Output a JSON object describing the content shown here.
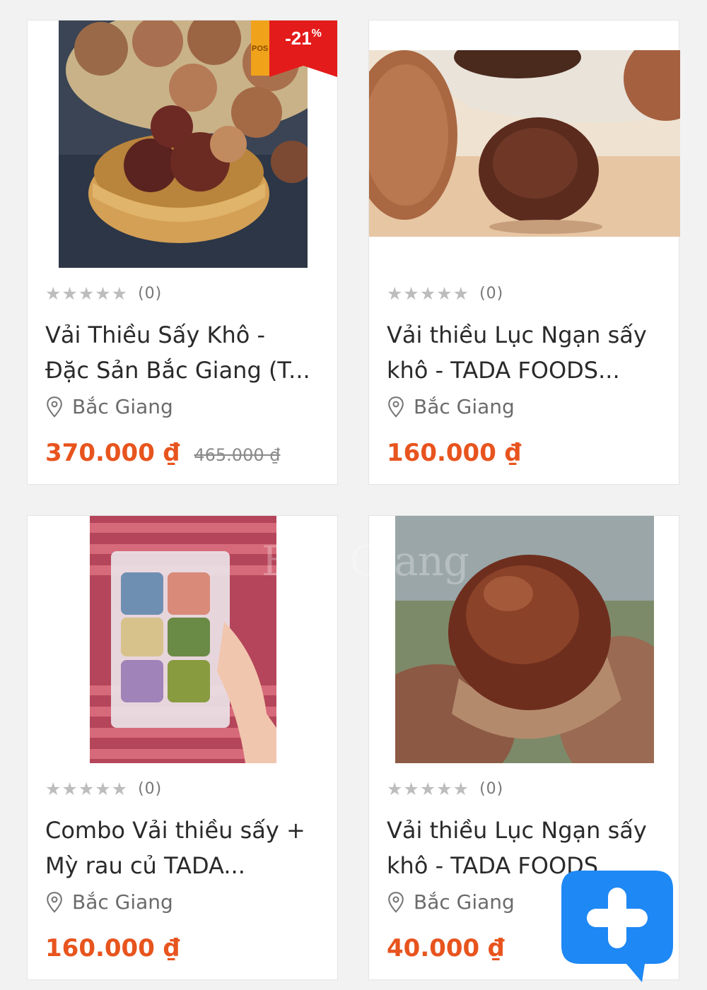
{
  "products": [
    {
      "rating_count": "(0)",
      "title_line1": "Vải Thiều Sấy Khô -",
      "title_line2": "Đặc Sản Bắc Giang (T...",
      "location": "Bắc Giang",
      "price": "370.000 ₫",
      "old_price": "465.000 ₫",
      "discount": "-21",
      "discount_unit": "%",
      "brand_tag": "POS"
    },
    {
      "rating_count": "(0)",
      "title_line1": "Vải thiều Lục Ngạn sấy",
      "title_line2": "khô - TADA FOODS...",
      "location": "Bắc Giang",
      "price": "160.000 ₫"
    },
    {
      "rating_count": "(0)",
      "title_line1": "Combo Vải thiều sấy +",
      "title_line2": "Mỳ rau củ TADA...",
      "location": "Bắc Giang",
      "price": "160.000 ₫"
    },
    {
      "rating_count": "(0)",
      "title_line1": "Vải thiều Lục Ngạn sấy",
      "title_line2": "khô - TADA FOODS...",
      "location": "Bắc Giang",
      "price": "40.000 ₫"
    }
  ],
  "stars": "★★★★★",
  "watermark": "Bắc Giang",
  "icons": {
    "location": "map-pin-icon",
    "fab": "add-post-icon"
  },
  "colors": {
    "price": "#e8541e",
    "badge": "#e41b1b",
    "fab": "#1e88f5"
  }
}
